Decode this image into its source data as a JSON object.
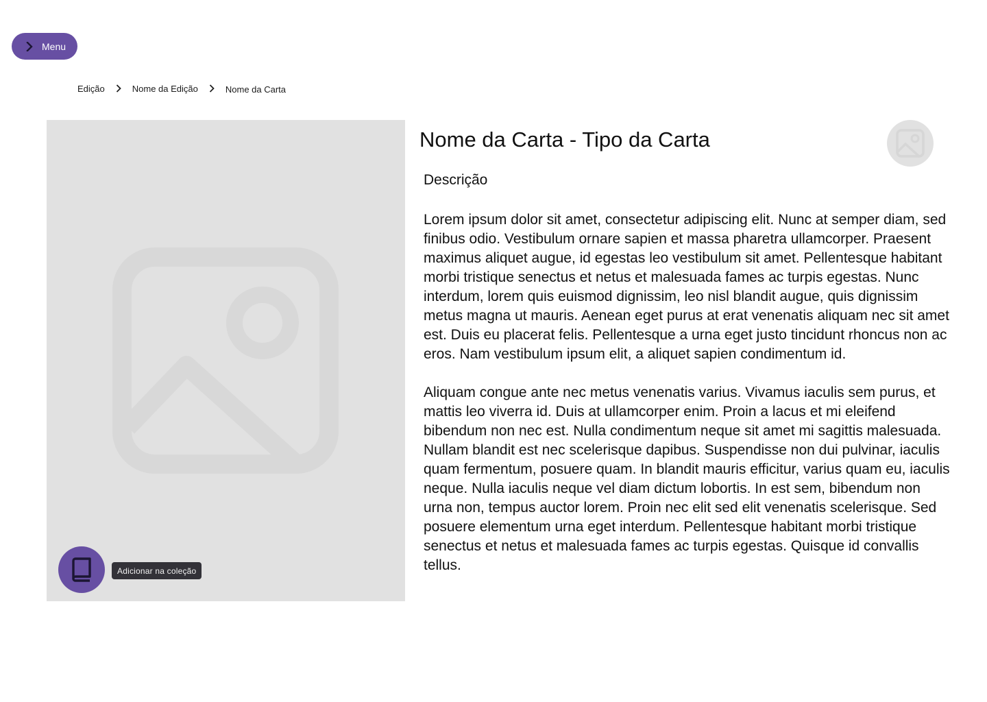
{
  "menu": {
    "label": "Menu",
    "icon": "chevron-right-icon"
  },
  "breadcrumb": {
    "items": [
      "Edição",
      "Nome da Edição",
      "Nome da Carta"
    ],
    "separator_icon": "chevron-right-icon"
  },
  "card": {
    "image_icon": "image-placeholder-icon",
    "type_icon": "image-placeholder-icon",
    "title": "Nome da Carta - Tipo da Carta",
    "description_heading": "Descrição",
    "description_paragraphs": [
      "Lorem ipsum dolor sit amet, consectetur adipiscing elit. Nunc at semper diam, sed finibus odio. Vestibulum ornare sapien et massa pharetra ullamcorper. Praesent maximus aliquet augue, id egestas leo vestibulum sit amet. Pellentesque habitant morbi tristique senectus et netus et malesuada fames ac turpis egestas. Nunc interdum, lorem quis euismod dignissim, leo nisl blandit augue, quis dignissim metus magna ut mauris. Aenean eget purus at erat venenatis aliquam nec sit amet est. Duis eu placerat felis. Pellentesque a urna eget justo tincidunt rhoncus non ac eros. Nam vestibulum ipsum elit, a aliquet sapien condimentum id.",
      "Aliquam congue ante nec metus venenatis varius. Vivamus iaculis sem purus, et mattis leo viverra id. Duis at ullamcorper enim. Proin a lacus et mi eleifend bibendum non nec est. Nulla condimentum neque sit amet mi sagittis malesuada. Nullam blandit est nec scelerisque dapibus. Suspendisse non dui pulvinar, iaculis quam fermentum, posuere quam. In blandit mauris efficitur, varius quam eu, iaculis neque. Nulla iaculis neque vel diam dictum lobortis. In est sem, bibendum non urna non, tempus auctor lorem. Proin nec elit sed elit venenatis scelerisque. Sed posuere elementum urna eget interdum. Pellentesque habitant morbi tristique senectus et netus et malesuada fames ac turpis egestas. Quisque id convallis tellus."
    ]
  },
  "collection": {
    "icon": "book-icon",
    "tooltip": "Adicionar na coleção"
  },
  "colors": {
    "primary": "#674fa3",
    "placeholder_bg": "#e1e1e1",
    "tooltip_bg": "#333238"
  }
}
